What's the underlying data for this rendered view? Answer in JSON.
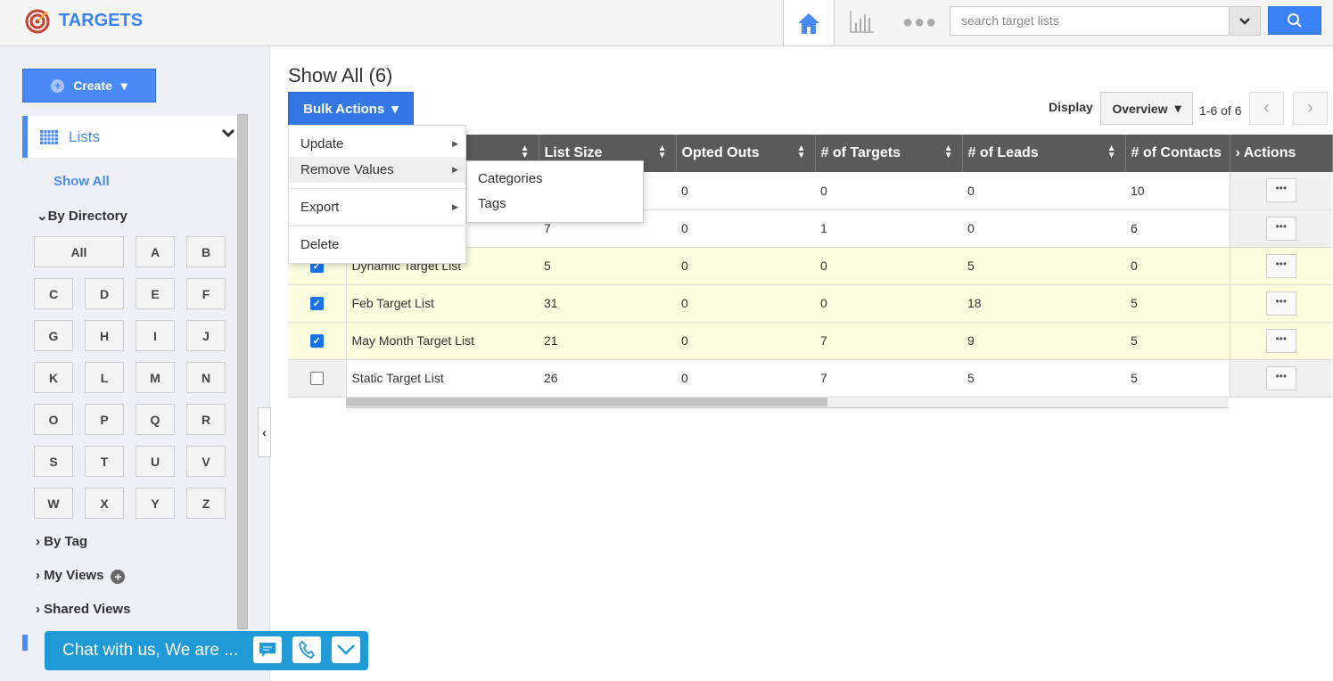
{
  "app": {
    "title": "TARGETS",
    "accent": "#3b82f6"
  },
  "topbar": {
    "search_placeholder": "search target lists",
    "icons": [
      "home-icon",
      "bar-chart-icon",
      "more-icon",
      "search-icon"
    ]
  },
  "sidebar": {
    "create_label": "Create",
    "lists_label": "Lists",
    "show_all": "Show All",
    "by_directory": "By Directory",
    "letters": [
      "All",
      "A",
      "B",
      "C",
      "D",
      "E",
      "F",
      "G",
      "H",
      "I",
      "J",
      "K",
      "L",
      "M",
      "N",
      "O",
      "P",
      "Q",
      "R",
      "S",
      "T",
      "U",
      "V",
      "W",
      "X",
      "Y",
      "Z"
    ],
    "by_tag": "By Tag",
    "my_views": "My Views",
    "shared_views": "Shared Views"
  },
  "main": {
    "title": "Show All (6)",
    "bulk_actions": "Bulk Actions",
    "display_label": "Display",
    "display_value": "Overview",
    "pager": "1-6 of 6"
  },
  "bulk_menu": {
    "items": [
      "Update",
      "Remove Values",
      "Export",
      "Delete"
    ],
    "submenu": [
      "Categories",
      "Tags"
    ]
  },
  "table": {
    "columns": [
      "List Size",
      "Opted Outs",
      "# of Targets",
      "# of Leads",
      "# of Contacts",
      "Actions"
    ],
    "rows": [
      {
        "name": "",
        "checked": false,
        "values": [
          "",
          "0",
          "0",
          "0",
          "10"
        ]
      },
      {
        "name": "",
        "checked": false,
        "values": [
          "7",
          "0",
          "1",
          "0",
          "6"
        ]
      },
      {
        "name": "Dynamic Target List",
        "checked": true,
        "values": [
          "5",
          "0",
          "0",
          "5",
          "0"
        ]
      },
      {
        "name": "Feb Target List",
        "checked": true,
        "values": [
          "31",
          "0",
          "0",
          "18",
          "5"
        ]
      },
      {
        "name": "May Month Target List",
        "checked": true,
        "values": [
          "21",
          "0",
          "7",
          "9",
          "5"
        ]
      },
      {
        "name": "Static Target List",
        "checked": false,
        "values": [
          "26",
          "0",
          "7",
          "5",
          "5"
        ]
      }
    ]
  },
  "chat": {
    "label": "Chat with us, We are ..."
  }
}
